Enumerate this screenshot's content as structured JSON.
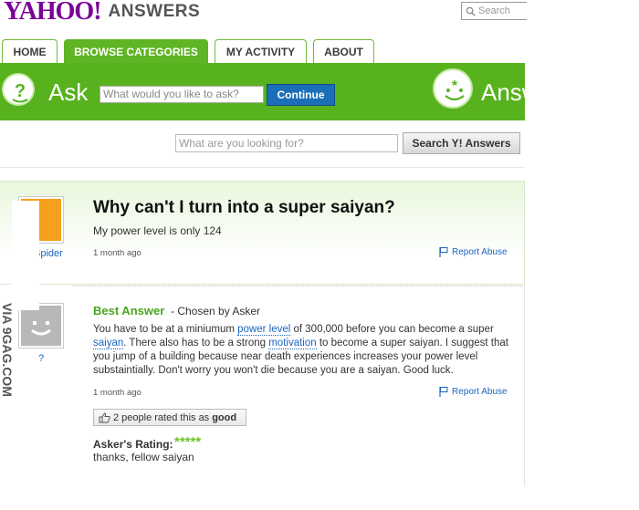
{
  "header": {
    "logo_yahoo": "YAHOO!",
    "logo_answers": "ANSWERS",
    "top_search_placeholder": "Search"
  },
  "tabs": [
    {
      "label": "HOME"
    },
    {
      "label": "BROWSE CATEGORIES"
    },
    {
      "label": "MY ACTIVITY"
    },
    {
      "label": "ABOUT"
    }
  ],
  "ask_bar": {
    "ask_label": "Ask",
    "ask_placeholder": "What would you like to ask?",
    "continue_label": "Continue",
    "answer_label": "Answer"
  },
  "search": {
    "placeholder": "What are you looking for?",
    "button_label": "Search Y! Answers"
  },
  "question": {
    "title": "Why can't I turn into a super saiyan?",
    "body": "My power level is only 124",
    "user": "Spider",
    "time": "1 month ago",
    "report": "Report Abuse"
  },
  "answer": {
    "heading": "Best Answer",
    "chosen_by": "- Chosen by Asker",
    "user": "?",
    "body_parts": [
      "You have to be at a miniumum ",
      "power level",
      " of 300,000 before you can become a super ",
      "saiyan",
      ". There also has to be a strong ",
      "motivation",
      " to become a super saiyan. I suggest that you jump of a building because near death experiences increases your power level substaintially. Don't worry you won't die because you are a saiyan. Good luck."
    ],
    "time": "1 month ago",
    "report": "Report Abuse",
    "rated_text": "2 people rated this as",
    "rated_value": "good",
    "askers_rating_label": "Asker's Rating:",
    "stars": "*****",
    "rating_comment": "thanks, fellow saiyan"
  },
  "watermark": "VIA 9GAG.COM",
  "colors": {
    "brand_purple": "#7b0099",
    "green": "#58b21e",
    "link_blue": "#1c66c0",
    "best_answer_green": "#4aa51c"
  }
}
